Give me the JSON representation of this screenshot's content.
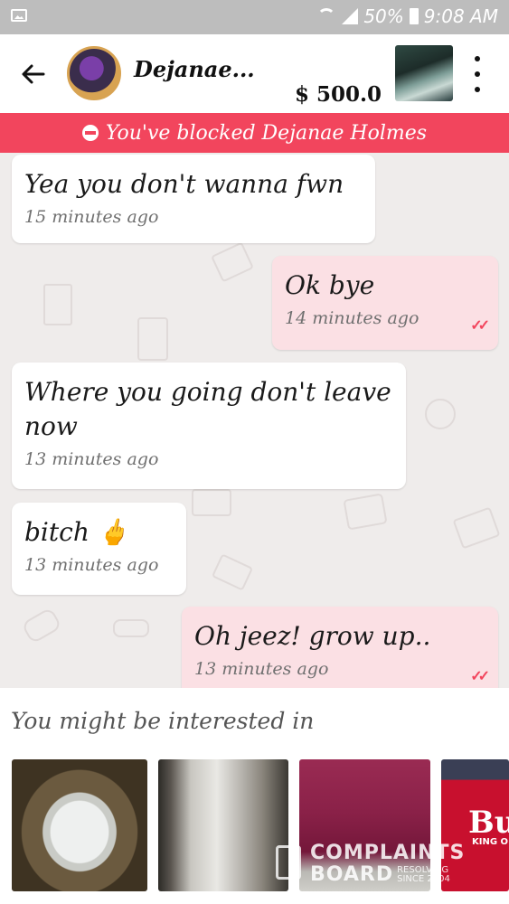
{
  "status_bar": {
    "battery": "50%",
    "time": "9:08 AM"
  },
  "header": {
    "contact_name": "Dejanae...",
    "price": "$ 500.0"
  },
  "blocked_notice": "You've blocked Dejanae Holmes",
  "messages": [
    {
      "direction": "in",
      "text": "Yea you don't wanna fwn",
      "time": "15 minutes ago"
    },
    {
      "direction": "out",
      "text": "Ok bye",
      "time": "14 minutes ago",
      "read": true
    },
    {
      "direction": "in",
      "text": "Where you going don't leave now",
      "time": "13 minutes ago"
    },
    {
      "direction": "in",
      "text": "bitch 🖕",
      "time": "13 minutes ago"
    },
    {
      "direction": "out",
      "text": "Oh jeez! grow up..",
      "time": "13 minutes ago",
      "read": true
    }
  ],
  "suggestions": {
    "title": "You might be interested in",
    "items": [
      {
        "image": "white-car-hood"
      },
      {
        "image": "silver-car-hood"
      },
      {
        "image": "maroon-car-hood"
      },
      {
        "image": "red-car-with-logo",
        "text": "Bu",
        "subtext": "KING O"
      }
    ]
  },
  "watermark": {
    "line1": "COMPLAINTS",
    "line2": "BOARD",
    "small": "RESOLVING\nSINCE 2004"
  },
  "colors": {
    "accent": "#f2455d",
    "outgoing_bubble": "#fbe0e4",
    "incoming_bubble": "#ffffff",
    "chat_background": "#efeceb"
  }
}
